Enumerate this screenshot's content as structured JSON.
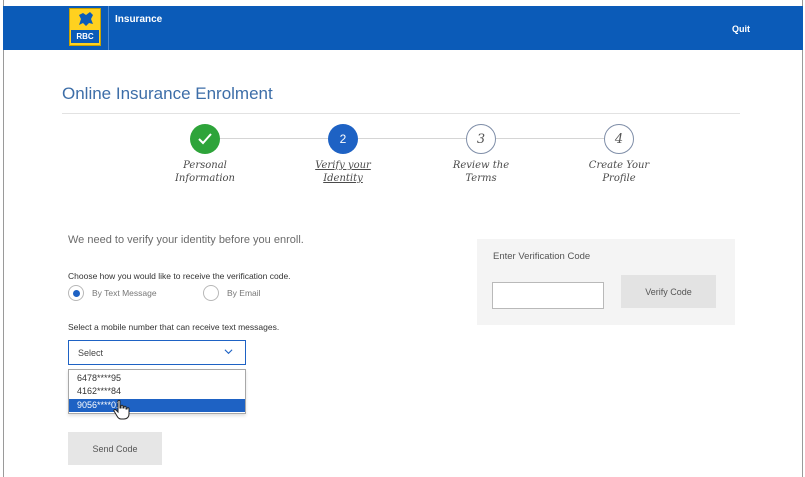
{
  "header": {
    "logo_text": "RBC",
    "app_name": "Insurance",
    "quit_label": "Quit"
  },
  "page": {
    "title": "Online Insurance Enrolment"
  },
  "steps": [
    {
      "number": "",
      "line1": "Personal",
      "line2": "Information",
      "state": "completed",
      "icon": "check-icon"
    },
    {
      "number": "2",
      "line1": "Verify your",
      "line2": "Identity",
      "state": "current"
    },
    {
      "number": "3",
      "line1": "Review the",
      "line2": "Terms",
      "state": "upcoming"
    },
    {
      "number": "4",
      "line1": "Create Your",
      "line2": "Profile",
      "state": "upcoming"
    }
  ],
  "verification": {
    "intro": "We need to verify your identity before you enroll.",
    "choose_prompt": "Choose how you would like to receive the verification code.",
    "options": [
      {
        "label": "By Text Message",
        "selected": true
      },
      {
        "label": "By Email",
        "selected": false
      }
    ],
    "mobile_prompt": "Select a mobile number that can receive text messages.",
    "select_value": "Select",
    "mobile_numbers": [
      {
        "label": "6478****95",
        "highlighted": false
      },
      {
        "label": "4162****84",
        "highlighted": false
      },
      {
        "label": "9056****01",
        "highlighted": true
      }
    ],
    "send_button": "Send Code"
  },
  "code_panel": {
    "label": "Enter Verification Code",
    "input_value": "",
    "verify_button": "Verify Code"
  },
  "colors": {
    "brand_blue": "#0b5bb8",
    "accent_blue": "#1e62c4",
    "success_green": "#2ea43a",
    "logo_yellow": "#ffd11f"
  }
}
